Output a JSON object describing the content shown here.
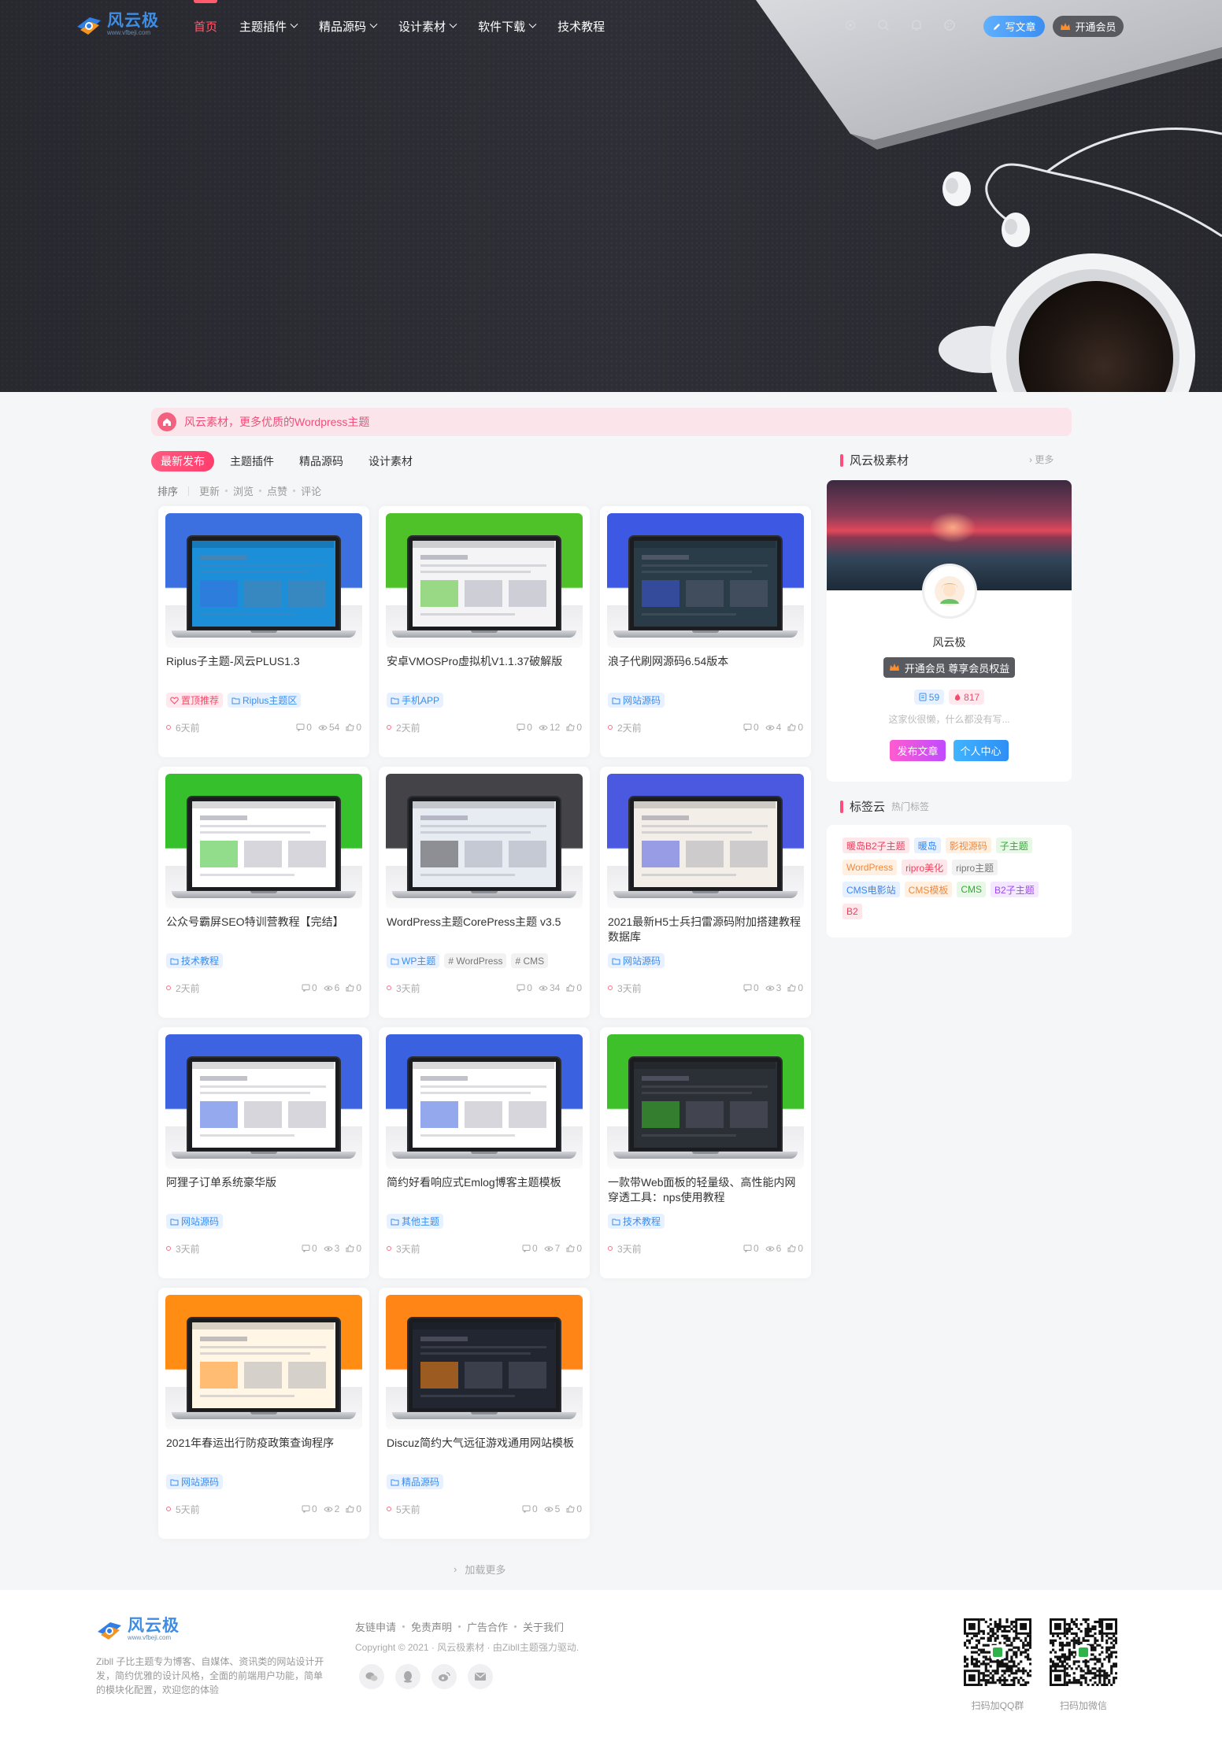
{
  "site": {
    "logo_text": "风云极",
    "logo_sub": "www.vfbeji.com"
  },
  "nav": {
    "items": [
      {
        "label": "首页",
        "active": true,
        "dropdown": false
      },
      {
        "label": "主题插件",
        "dropdown": true
      },
      {
        "label": "精品源码",
        "dropdown": true
      },
      {
        "label": "设计素材",
        "dropdown": true
      },
      {
        "label": "软件下载",
        "dropdown": true
      },
      {
        "label": "技术教程",
        "dropdown": false
      }
    ],
    "tools": [
      "theme-toggle-icon",
      "search-icon",
      "bell-icon",
      "palette-icon"
    ],
    "write_label": "写文章",
    "vip_label": "开通会员"
  },
  "notice": {
    "text": "风云素材，更多优质的Wordpress主题"
  },
  "tabs": [
    "最新发布",
    "主题插件",
    "精品源码",
    "设计素材"
  ],
  "sort": {
    "label": "排序",
    "options": [
      "更新",
      "浏览",
      "点赞",
      "评论"
    ]
  },
  "posts": [
    {
      "title": "Riplus子主题-风云PLUS1.3",
      "tags": [
        {
          "text": "置顶推荐",
          "style": "pink",
          "icon": "heart"
        },
        {
          "text": "Riplus主题区",
          "style": "blue",
          "icon": "folder"
        }
      ],
      "time": "6天前",
      "comments": "0",
      "views": "54",
      "likes": "0"
    },
    {
      "title": "安卓VMOSPro虚拟机V1.1.37破解版",
      "tags": [
        {
          "text": "手机APP",
          "style": "blue",
          "icon": "folder"
        }
      ],
      "time": "2天前",
      "comments": "0",
      "views": "12",
      "likes": "0"
    },
    {
      "title": "浪子代刷网源码6.54版本",
      "tags": [
        {
          "text": "网站源码",
          "style": "blue",
          "icon": "folder"
        }
      ],
      "time": "2天前",
      "comments": "0",
      "views": "4",
      "likes": "0"
    },
    {
      "title": "公众号霸屏SEO特训营教程【完结】",
      "tags": [
        {
          "text": "技术教程",
          "style": "blue",
          "icon": "folder"
        }
      ],
      "time": "2天前",
      "comments": "0",
      "views": "6",
      "likes": "0"
    },
    {
      "title": "WordPress主题CorePress主题 v3.5",
      "tags": [
        {
          "text": "WP主题",
          "style": "blue",
          "icon": "folder"
        },
        {
          "text": "# WordPress",
          "style": "gray",
          "icon": ""
        },
        {
          "text": "# CMS",
          "style": "gray",
          "icon": ""
        }
      ],
      "time": "3天前",
      "comments": "0",
      "views": "34",
      "likes": "0"
    },
    {
      "title": "2021最新H5士兵扫雷源码附加搭建教程数据库",
      "tags": [
        {
          "text": "网站源码",
          "style": "blue",
          "icon": "folder"
        }
      ],
      "time": "3天前",
      "comments": "0",
      "views": "3",
      "likes": "0"
    },
    {
      "title": "阿狸子订单系统豪华版",
      "tags": [
        {
          "text": "网站源码",
          "style": "blue",
          "icon": "folder"
        }
      ],
      "time": "3天前",
      "comments": "0",
      "views": "3",
      "likes": "0"
    },
    {
      "title": "简约好看响应式Emlog博客主题模板",
      "tags": [
        {
          "text": "其他主题",
          "style": "blue",
          "icon": "folder"
        }
      ],
      "time": "3天前",
      "comments": "0",
      "views": "7",
      "likes": "0"
    },
    {
      "title": "一款带Web面板的轻量级、高性能内网穿透工具：nps使用教程",
      "tags": [
        {
          "text": "技术教程",
          "style": "blue",
          "icon": "folder"
        }
      ],
      "time": "3天前",
      "comments": "0",
      "views": "6",
      "likes": "0"
    },
    {
      "title": "2021年春运出行防疫政策查询程序",
      "tags": [
        {
          "text": "网站源码",
          "style": "blue",
          "icon": "folder"
        }
      ],
      "time": "5天前",
      "comments": "0",
      "views": "2",
      "likes": "0"
    },
    {
      "title": "Discuz简约大气远征游戏通用网站模板",
      "tags": [
        {
          "text": "精品源码",
          "style": "blue",
          "icon": "folder"
        }
      ],
      "time": "5天前",
      "comments": "0",
      "views": "5",
      "likes": "0"
    }
  ],
  "thumb_colors": [
    "#3c6fe0",
    "#4fc22a",
    "#3d58e2",
    "#36c12c",
    "#444448",
    "#4b58e0",
    "#3e63e0",
    "#3a61df",
    "#3dc02a",
    "#ff8d13",
    "#ff8616"
  ],
  "thumb_screens": [
    "#1c8fd8",
    "#f4f4f6",
    "#2a3c48",
    "#ffffff",
    "#e7ecf2",
    "#f3efe8",
    "#ffffff",
    "#ffffff",
    "#2b2f36",
    "#fff6e6",
    "#222630"
  ],
  "load_more": "加载更多",
  "sidebar": {
    "profile_title": "风云极素材",
    "more": "更多",
    "name": "风云极",
    "vip_text": "开通会员 尊享会员权益",
    "posts_count": "59",
    "hot_count": "817",
    "desc": "这家伙很懒，什么都没有写...",
    "btn_publish": "发布文章",
    "btn_center": "个人中心",
    "tags_title": "标签云",
    "tags_sub": "热门标签",
    "tags": [
      {
        "text": "暖岛B2子主题",
        "bg": "#fde7ea",
        "color": "#e8435f"
      },
      {
        "text": "暖岛",
        "bg": "#e6f0ff",
        "color": "#3a86f0"
      },
      {
        "text": "影视源码",
        "bg": "#fff0e2",
        "color": "#f0883a"
      },
      {
        "text": "子主题",
        "bg": "#e8f8e6",
        "color": "#37a83a"
      },
      {
        "text": "WordPress",
        "bg": "#fff0e2",
        "color": "#f0883a"
      },
      {
        "text": "ripro美化",
        "bg": "#fde7ea",
        "color": "#e8435f"
      },
      {
        "text": "ripro主题",
        "bg": "#f2f2f2",
        "color": "#777777"
      },
      {
        "text": "CMS电影站",
        "bg": "#e6f0ff",
        "color": "#3a86f0"
      },
      {
        "text": "CMS模板",
        "bg": "#fff0e2",
        "color": "#f0883a"
      },
      {
        "text": "CMS",
        "bg": "#e8f8e6",
        "color": "#37a83a"
      },
      {
        "text": "B2子主题",
        "bg": "#f3e8ff",
        "color": "#9b4bf0"
      },
      {
        "text": "B2",
        "bg": "#fde7ea",
        "color": "#e8435f"
      }
    ]
  },
  "footer": {
    "desc": "Zibll 子比主题专为博客、自媒体、资讯类的网站设计开发，简约优雅的设计风格，全面的前端用户功能，简单的模块化配置，欢迎您的体验",
    "links": [
      "友链申请",
      "免责声明",
      "广告合作",
      "关于我们"
    ],
    "copyright": "Copyright © 2021 · 风云极素材 · 由Zibll主题强力驱动.",
    "qr1_label": "扫码加QQ群",
    "qr2_label": "扫码加微信"
  }
}
